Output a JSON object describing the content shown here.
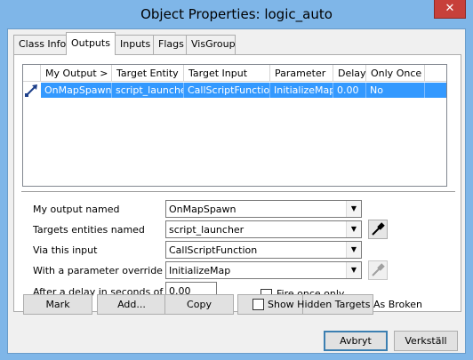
{
  "window": {
    "title": "Object Properties: logic_auto",
    "close_glyph": "✕"
  },
  "tabs": [
    {
      "label": "Class Info",
      "active": false
    },
    {
      "label": "Outputs",
      "active": true
    },
    {
      "label": "Inputs",
      "active": false
    },
    {
      "label": "Flags",
      "active": false
    },
    {
      "label": "VisGroup",
      "active": false
    }
  ],
  "outputs_list": {
    "columns": [
      "My Output",
      "Target Entity",
      "Target Input",
      "Parameter",
      "Delay",
      "Only Once"
    ],
    "sort_indicator": ">",
    "rows": [
      {
        "icon": "output-connection-icon",
        "my_output": "OnMapSpawn",
        "target_entity": "script_launcher",
        "target_input": "CallScriptFunction",
        "parameter": "InitializeMap",
        "delay": "0.00",
        "only_once": "No",
        "selected": true
      }
    ]
  },
  "form": {
    "output_named": {
      "label": "My output named",
      "value": "OnMapSpawn"
    },
    "targets_named": {
      "label": "Targets entities named",
      "value": "script_launcher"
    },
    "via_input": {
      "label": "Via this input",
      "value": "CallScriptFunction"
    },
    "parameter_override": {
      "label": "With a parameter override of",
      "value": "InitializeMap"
    },
    "delay": {
      "label": "After a delay in seconds of",
      "value": "0.00"
    },
    "fire_once": {
      "label": "Fire once only",
      "checked": false
    }
  },
  "actions": {
    "mark": "Mark",
    "add": "Add...",
    "copy": "Copy",
    "show_hidden": {
      "label": "Show Hidden Targets As Broken",
      "checked": false
    }
  },
  "footer": {
    "cancel": "Avbryt",
    "apply": "Verkställ"
  },
  "colors": {
    "selection": "#3399ff",
    "window_frame": "#7fb6e8",
    "close_button": "#c7403a"
  }
}
